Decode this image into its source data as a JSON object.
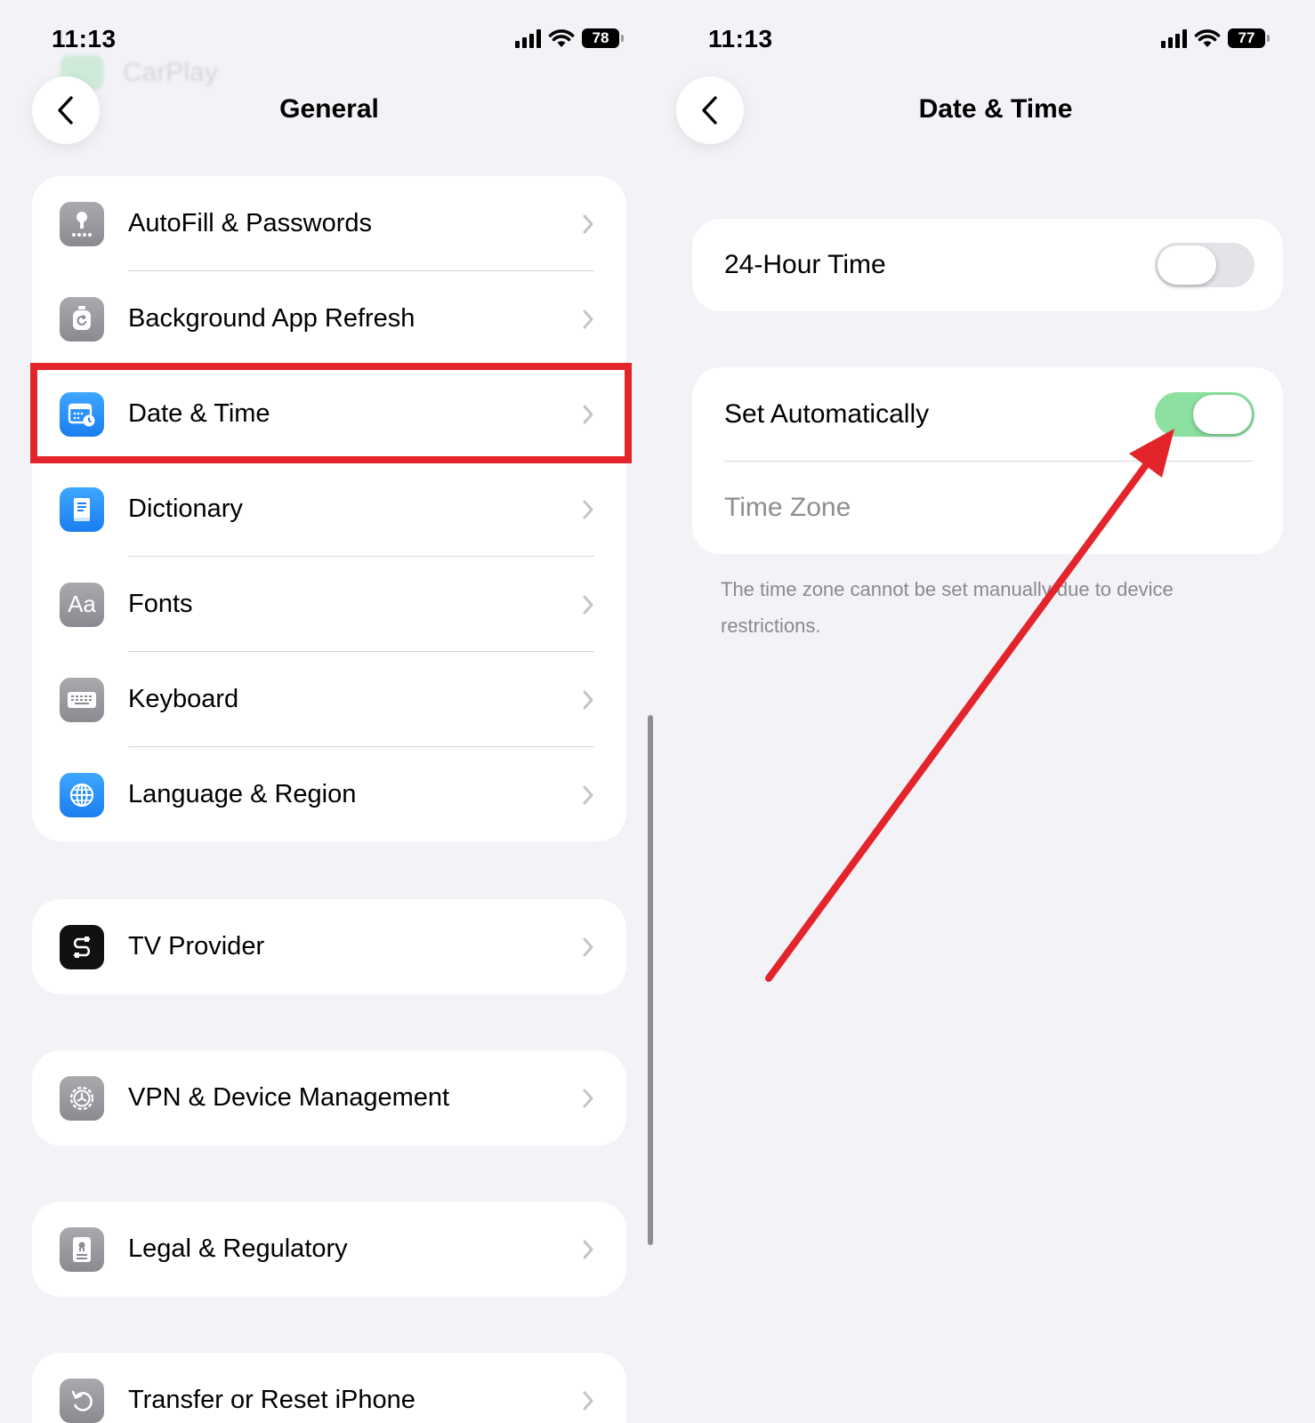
{
  "colors": {
    "background": "#f2f2f7",
    "card": "#ffffff",
    "highlight": "#e3242b",
    "toggle_on": "#8ce0a0",
    "toggle_off": "#e3e3e8",
    "chevron": "#c4c4c7",
    "secondary_text": "#8a8a8e"
  },
  "left_screen": {
    "status": {
      "time": "11:13",
      "battery": "78"
    },
    "ghost_row_label": "CarPlay",
    "nav": {
      "title": "General"
    },
    "groups": [
      {
        "items": [
          {
            "label": "AutoFill & Passwords",
            "icon": "key-icon"
          },
          {
            "label": "Background App Refresh",
            "icon": "refresh-icon"
          },
          {
            "label": "Date & Time",
            "icon": "calendar-clock-icon"
          },
          {
            "label": "Dictionary",
            "icon": "book-icon"
          },
          {
            "label": "Fonts",
            "icon": "fonts-icon",
            "glyph": "Aa"
          },
          {
            "label": "Keyboard",
            "icon": "keyboard-icon"
          },
          {
            "label": "Language & Region",
            "icon": "globe-icon"
          }
        ]
      },
      {
        "items": [
          {
            "label": "TV Provider",
            "icon": "tv-provider-icon"
          }
        ]
      },
      {
        "items": [
          {
            "label": "VPN & Device Management",
            "icon": "gear-icon"
          }
        ]
      },
      {
        "items": [
          {
            "label": "Legal & Regulatory",
            "icon": "document-icon"
          }
        ]
      },
      {
        "items": [
          {
            "label": "Transfer or Reset iPhone",
            "icon": "reset-icon"
          }
        ]
      }
    ]
  },
  "right_screen": {
    "status": {
      "time": "11:13",
      "battery": "77"
    },
    "nav": {
      "title": "Date & Time"
    },
    "hour24": {
      "label": "24-Hour Time",
      "on": false
    },
    "set_auto": {
      "label": "Set Automatically",
      "on": true
    },
    "time_zone": {
      "label": "Time Zone"
    },
    "footnote": "The time zone cannot be set manually due to device restrictions."
  }
}
